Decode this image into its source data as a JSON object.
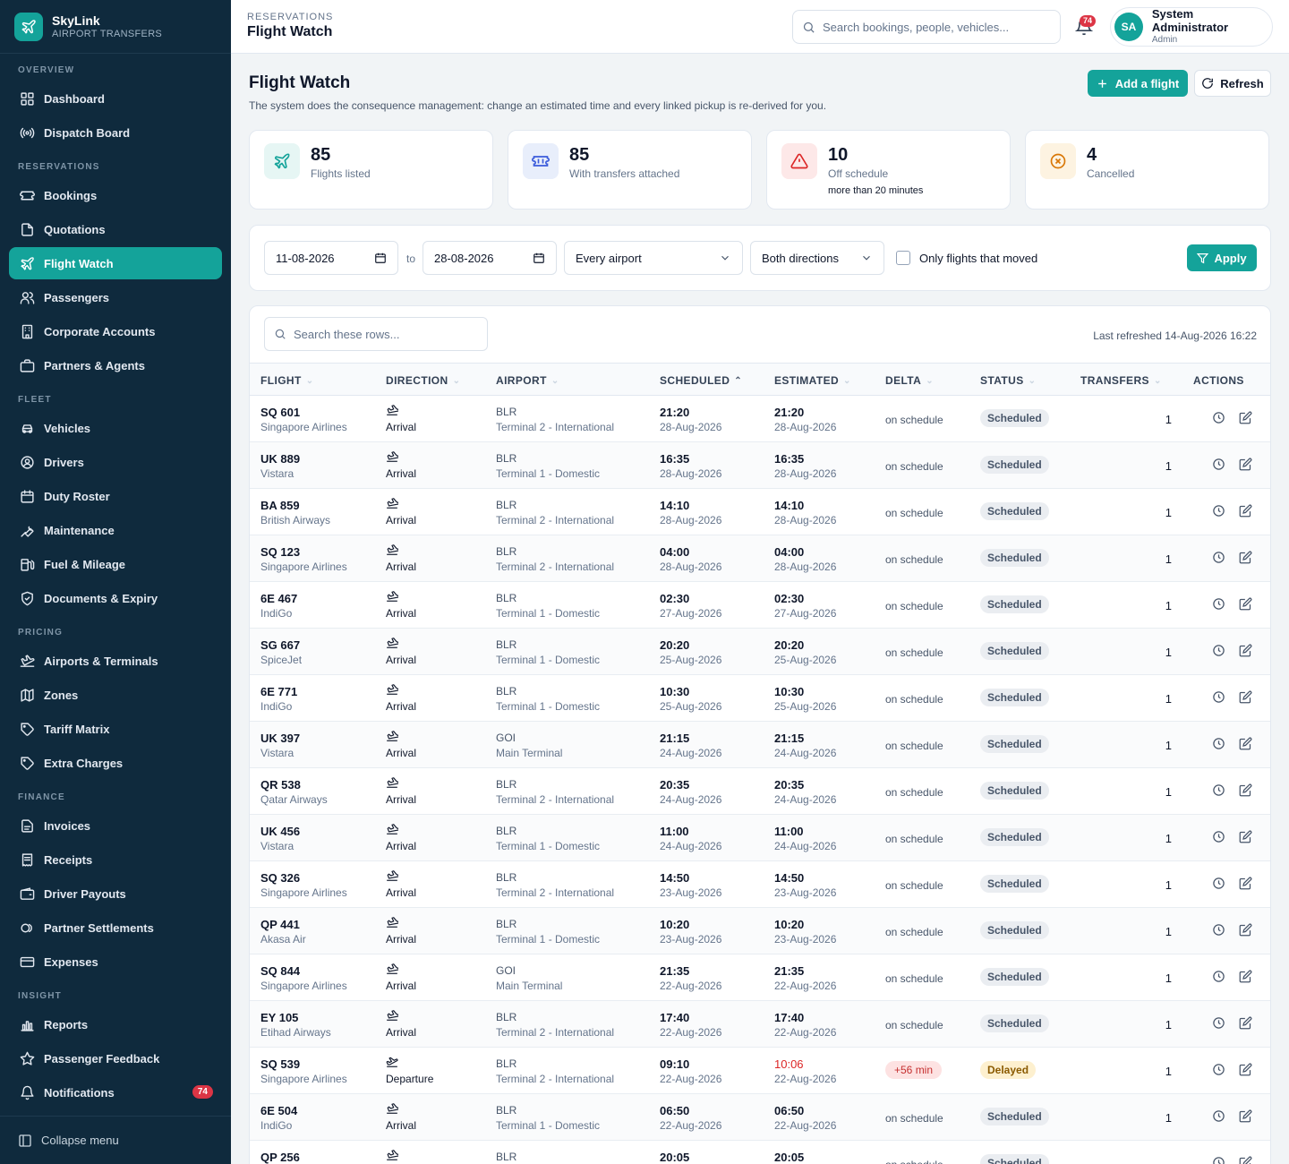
{
  "brand": {
    "name": "SkyLink",
    "sub": "AIRPORT TRANSFERS"
  },
  "sidebar": {
    "sections": [
      {
        "label": "OVERVIEW"
      },
      {
        "label": "RESERVATIONS"
      },
      {
        "label": "FLEET"
      },
      {
        "label": "PRICING"
      },
      {
        "label": "FINANCE"
      },
      {
        "label": "INSIGHT"
      }
    ],
    "items": [
      {
        "label": "Dashboard",
        "icon": "grid-icon"
      },
      {
        "label": "Dispatch Board",
        "icon": "broadcast-icon"
      },
      {
        "label": "Bookings",
        "icon": "ticket-icon"
      },
      {
        "label": "Quotations",
        "icon": "document-icon"
      },
      {
        "label": "Flight Watch",
        "icon": "plane-icon",
        "active": true
      },
      {
        "label": "Passengers",
        "icon": "users-icon"
      },
      {
        "label": "Corporate Accounts",
        "icon": "building-icon"
      },
      {
        "label": "Partners & Agents",
        "icon": "briefcase-icon"
      },
      {
        "label": "Vehicles",
        "icon": "car-icon"
      },
      {
        "label": "Drivers",
        "icon": "driver-icon"
      },
      {
        "label": "Duty Roster",
        "icon": "calendar-icon"
      },
      {
        "label": "Maintenance",
        "icon": "wrench-icon"
      },
      {
        "label": "Fuel & Mileage",
        "icon": "fuel-icon"
      },
      {
        "label": "Documents & Expiry",
        "icon": "shield-icon"
      },
      {
        "label": "Airports & Terminals",
        "icon": "runway-icon"
      },
      {
        "label": "Zones",
        "icon": "map-icon"
      },
      {
        "label": "Tariff Matrix",
        "icon": "tag-icon"
      },
      {
        "label": "Extra Charges",
        "icon": "tags-icon"
      },
      {
        "label": "Invoices",
        "icon": "invoice-icon"
      },
      {
        "label": "Receipts",
        "icon": "receipt-icon"
      },
      {
        "label": "Driver Payouts",
        "icon": "wallet-icon"
      },
      {
        "label": "Partner Settlements",
        "icon": "coins-icon"
      },
      {
        "label": "Expenses",
        "icon": "card-icon"
      },
      {
        "label": "Reports",
        "icon": "bar-chart-icon"
      },
      {
        "label": "Passenger Feedback",
        "icon": "star-icon"
      },
      {
        "label": "Notifications",
        "icon": "bell-icon",
        "badge": "74"
      }
    ],
    "collapse_label": "Collapse menu"
  },
  "topbar": {
    "crumb": "RESERVATIONS",
    "title": "Flight Watch",
    "search_placeholder": "Search bookings, people, vehicles...",
    "notif_count": "74",
    "user": {
      "initials": "SA",
      "name": "System Administrator",
      "role": "Admin"
    }
  },
  "page": {
    "title": "Flight Watch",
    "subtitle": "The system does the consequence management: change an estimated time and every linked pickup is re-derived for you.",
    "add_label": "Add a flight",
    "refresh_label": "Refresh"
  },
  "stats": [
    {
      "value": "85",
      "label": "Flights listed",
      "note": "",
      "color": "#e6f6f4"
    },
    {
      "value": "85",
      "label": "With transfers attached",
      "note": "",
      "color": "#e8eefb"
    },
    {
      "value": "10",
      "label": "Off schedule",
      "note": "more than 20 minutes",
      "color": "#fde8e8"
    },
    {
      "value": "4",
      "label": "Cancelled",
      "note": "",
      "color": "#fdf3e1"
    }
  ],
  "filters": {
    "date_from": "11-08-2026",
    "to_label": "to",
    "date_to": "28-08-2026",
    "airport": "Every airport",
    "direction": "Both directions",
    "moved_label": "Only flights that moved",
    "apply_label": "Apply"
  },
  "table": {
    "search_placeholder": "Search these rows...",
    "last_refreshed": "Last refreshed 14-Aug-2026 16:22",
    "columns": [
      "FLIGHT",
      "DIRECTION",
      "AIRPORT",
      "SCHEDULED",
      "ESTIMATED",
      "DELTA",
      "STATUS",
      "TRANSFERS",
      "ACTIONS"
    ],
    "rows": [
      {
        "flight": "SQ 601",
        "airline": "Singapore Airlines",
        "direction": "Arrival",
        "airport": "BLR",
        "terminal": "Terminal 2 - International",
        "sched_time": "21:20",
        "sched_date": "28-Aug-2026",
        "est_time": "21:20",
        "est_date": "28-Aug-2026",
        "delta": "on schedule",
        "status": "Scheduled",
        "transfers": "1"
      },
      {
        "flight": "UK 889",
        "airline": "Vistara",
        "direction": "Arrival",
        "airport": "BLR",
        "terminal": "Terminal 1 - Domestic",
        "sched_time": "16:35",
        "sched_date": "28-Aug-2026",
        "est_time": "16:35",
        "est_date": "28-Aug-2026",
        "delta": "on schedule",
        "status": "Scheduled",
        "transfers": "1"
      },
      {
        "flight": "BA 859",
        "airline": "British Airways",
        "direction": "Arrival",
        "airport": "BLR",
        "terminal": "Terminal 2 - International",
        "sched_time": "14:10",
        "sched_date": "28-Aug-2026",
        "est_time": "14:10",
        "est_date": "28-Aug-2026",
        "delta": "on schedule",
        "status": "Scheduled",
        "transfers": "1"
      },
      {
        "flight": "SQ 123",
        "airline": "Singapore Airlines",
        "direction": "Arrival",
        "airport": "BLR",
        "terminal": "Terminal 2 - International",
        "sched_time": "04:00",
        "sched_date": "28-Aug-2026",
        "est_time": "04:00",
        "est_date": "28-Aug-2026",
        "delta": "on schedule",
        "status": "Scheduled",
        "transfers": "1"
      },
      {
        "flight": "6E 467",
        "airline": "IndiGo",
        "direction": "Arrival",
        "airport": "BLR",
        "terminal": "Terminal 1 - Domestic",
        "sched_time": "02:30",
        "sched_date": "27-Aug-2026",
        "est_time": "02:30",
        "est_date": "27-Aug-2026",
        "delta": "on schedule",
        "status": "Scheduled",
        "transfers": "1"
      },
      {
        "flight": "SG 667",
        "airline": "SpiceJet",
        "direction": "Arrival",
        "airport": "BLR",
        "terminal": "Terminal 1 - Domestic",
        "sched_time": "20:20",
        "sched_date": "25-Aug-2026",
        "est_time": "20:20",
        "est_date": "25-Aug-2026",
        "delta": "on schedule",
        "status": "Scheduled",
        "transfers": "1"
      },
      {
        "flight": "6E 771",
        "airline": "IndiGo",
        "direction": "Arrival",
        "airport": "BLR",
        "terminal": "Terminal 1 - Domestic",
        "sched_time": "10:30",
        "sched_date": "25-Aug-2026",
        "est_time": "10:30",
        "est_date": "25-Aug-2026",
        "delta": "on schedule",
        "status": "Scheduled",
        "transfers": "1"
      },
      {
        "flight": "UK 397",
        "airline": "Vistara",
        "direction": "Arrival",
        "airport": "GOI",
        "terminal": "Main Terminal",
        "sched_time": "21:15",
        "sched_date": "24-Aug-2026",
        "est_time": "21:15",
        "est_date": "24-Aug-2026",
        "delta": "on schedule",
        "status": "Scheduled",
        "transfers": "1"
      },
      {
        "flight": "QR 538",
        "airline": "Qatar Airways",
        "direction": "Arrival",
        "airport": "BLR",
        "terminal": "Terminal 2 - International",
        "sched_time": "20:35",
        "sched_date": "24-Aug-2026",
        "est_time": "20:35",
        "est_date": "24-Aug-2026",
        "delta": "on schedule",
        "status": "Scheduled",
        "transfers": "1"
      },
      {
        "flight": "UK 456",
        "airline": "Vistara",
        "direction": "Arrival",
        "airport": "BLR",
        "terminal": "Terminal 1 - Domestic",
        "sched_time": "11:00",
        "sched_date": "24-Aug-2026",
        "est_time": "11:00",
        "est_date": "24-Aug-2026",
        "delta": "on schedule",
        "status": "Scheduled",
        "transfers": "1"
      },
      {
        "flight": "SQ 326",
        "airline": "Singapore Airlines",
        "direction": "Arrival",
        "airport": "BLR",
        "terminal": "Terminal 2 - International",
        "sched_time": "14:50",
        "sched_date": "23-Aug-2026",
        "est_time": "14:50",
        "est_date": "23-Aug-2026",
        "delta": "on schedule",
        "status": "Scheduled",
        "transfers": "1"
      },
      {
        "flight": "QP 441",
        "airline": "Akasa Air",
        "direction": "Arrival",
        "airport": "BLR",
        "terminal": "Terminal 1 - Domestic",
        "sched_time": "10:20",
        "sched_date": "23-Aug-2026",
        "est_time": "10:20",
        "est_date": "23-Aug-2026",
        "delta": "on schedule",
        "status": "Scheduled",
        "transfers": "1"
      },
      {
        "flight": "SQ 844",
        "airline": "Singapore Airlines",
        "direction": "Arrival",
        "airport": "GOI",
        "terminal": "Main Terminal",
        "sched_time": "21:35",
        "sched_date": "22-Aug-2026",
        "est_time": "21:35",
        "est_date": "22-Aug-2026",
        "delta": "on schedule",
        "status": "Scheduled",
        "transfers": "1"
      },
      {
        "flight": "EY 105",
        "airline": "Etihad Airways",
        "direction": "Arrival",
        "airport": "BLR",
        "terminal": "Terminal 2 - International",
        "sched_time": "17:40",
        "sched_date": "22-Aug-2026",
        "est_time": "17:40",
        "est_date": "22-Aug-2026",
        "delta": "on schedule",
        "status": "Scheduled",
        "transfers": "1"
      },
      {
        "flight": "SQ 539",
        "airline": "Singapore Airlines",
        "direction": "Departure",
        "airport": "BLR",
        "terminal": "Terminal 2 - International",
        "sched_time": "09:10",
        "sched_date": "22-Aug-2026",
        "est_time": "10:06",
        "est_date": "22-Aug-2026",
        "delta": "+56 min",
        "status": "Delayed",
        "transfers": "1"
      },
      {
        "flight": "6E 504",
        "airline": "IndiGo",
        "direction": "Arrival",
        "airport": "BLR",
        "terminal": "Terminal 1 - Domestic",
        "sched_time": "06:50",
        "sched_date": "22-Aug-2026",
        "est_time": "06:50",
        "est_date": "22-Aug-2026",
        "delta": "on schedule",
        "status": "Scheduled",
        "transfers": "1"
      },
      {
        "flight": "QP 256",
        "airline": "",
        "direction": "",
        "airport": "BLR",
        "terminal": "",
        "sched_time": "20:05",
        "sched_date": "",
        "est_time": "20:05",
        "est_date": "",
        "delta": "on schedule",
        "status": "Scheduled",
        "transfers": ""
      }
    ]
  },
  "colors": {
    "accent": "#14a39a",
    "sidebar": "#0f2a3d",
    "danger": "#dc3545"
  }
}
